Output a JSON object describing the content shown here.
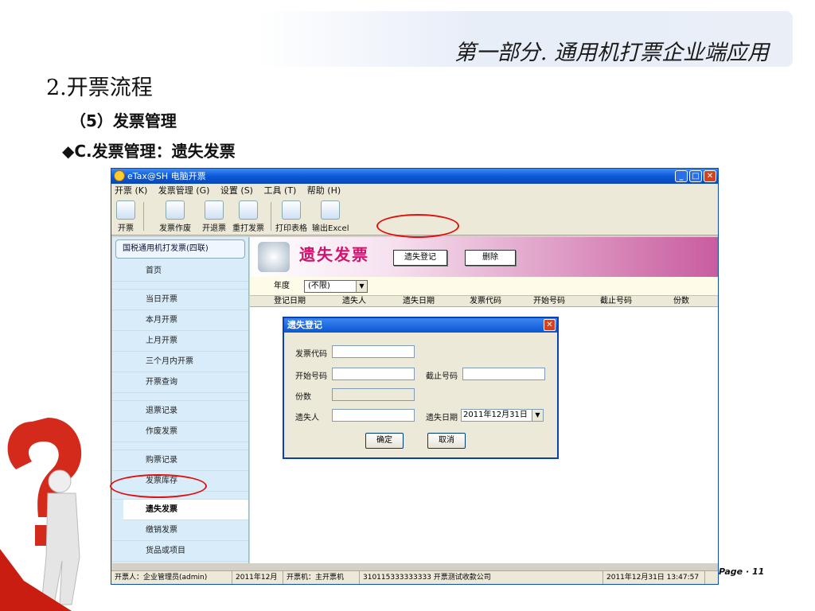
{
  "slide": {
    "header": "第一部分. 通用机打票企业端应用",
    "heading": "2.开票流程",
    "sub_heading": "（5）发票管理",
    "topic": "◆C.发票管理：遗失发票",
    "page": "Page · 11"
  },
  "window": {
    "title": "eTax@SH 电脑开票",
    "min": "_",
    "max": "□",
    "close": "✕"
  },
  "menu": [
    "开票 (K)",
    "发票管理 (G)",
    "设置 (S)",
    "工具 (T)",
    "帮助 (H)"
  ],
  "toolbar": [
    "开票",
    "发票作废",
    "开退票",
    "重打发票",
    "打印表格",
    "输出Excel"
  ],
  "sidebar": {
    "header": "国税通用机打发票(四联)",
    "items": {
      "home": "首页",
      "today": "当日开票",
      "month": "本月开票",
      "last_month": "上月开票",
      "three_months": "三个月内开票",
      "query": "开票查询",
      "refund": "退票记录",
      "void": "作废发票",
      "purchase": "购票记录",
      "stock": "发票库存",
      "lost": "遗失发票",
      "cancel": "缴销发票",
      "goods": "货品或项目"
    }
  },
  "banner": {
    "title": "遗失发票",
    "register_btn": "遗失登记",
    "delete_btn": "删除"
  },
  "filter": {
    "label": "年度",
    "value": "(不限)",
    "arrow": "▼"
  },
  "table_headers": [
    "登记日期",
    "遗失人",
    "遗失日期",
    "发票代码",
    "开始号码",
    "截止号码",
    "份数"
  ],
  "dialog": {
    "title": "遗失登记",
    "close": "✕",
    "code_label": "发票代码",
    "start_label": "开始号码",
    "end_label": "截止号码",
    "count_label": "份数",
    "person_label": "遗失人",
    "date_label": "遗失日期",
    "date_value": "2011年12月31日",
    "date_arrow": "▼",
    "ok": "确定",
    "cancel": "取消"
  },
  "status": {
    "user": "开票人：企业管理员(admin)",
    "period": "2011年12月",
    "machine": "开票机：主开票机",
    "company": "310115333333333 开票测试收款公司",
    "datetime": "2011年12月31日 13:47:57"
  },
  "colors": {
    "accent_red": "#e01010",
    "banner_pink": "#d2136d",
    "titlebar_blue": "#0b59d8"
  }
}
